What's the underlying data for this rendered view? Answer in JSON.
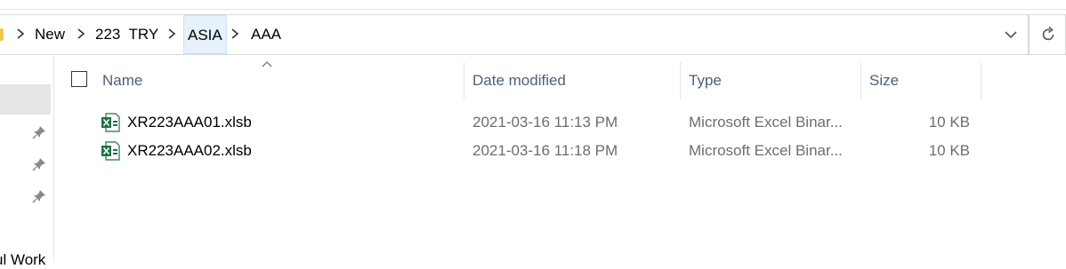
{
  "breadcrumbs": [
    {
      "label": "New"
    },
    {
      "label": "223  TRY"
    },
    {
      "label": "ASIA"
    },
    {
      "label": "AAA"
    }
  ],
  "columns": {
    "name": "Name",
    "date_modified": "Date modified",
    "type": "Type",
    "size": "Size"
  },
  "files": [
    {
      "name": "XR223AAA01.xlsb",
      "date_modified": "2021-03-16 11:13 PM",
      "type": "Microsoft Excel Binar...",
      "size": "10 KB"
    },
    {
      "name": "XR223AAA02.xlsb",
      "date_modified": "2021-03-16 11:18 PM",
      "type": "Microsoft Excel Binar...",
      "size": "10 KB"
    }
  ],
  "nav": {
    "partial_label": "ul Work"
  },
  "icons": {
    "file_icon": "excel-file-icon",
    "pin_icon": "pin-icon",
    "refresh_icon": "refresh-icon",
    "dropdown_icon": "chevron-down-icon"
  },
  "colors": {
    "header_text": "#4c607a",
    "secondary_text": "#6d6d6d",
    "selection_bg": "#e5f1fb",
    "excel_green": "#1f7244"
  }
}
